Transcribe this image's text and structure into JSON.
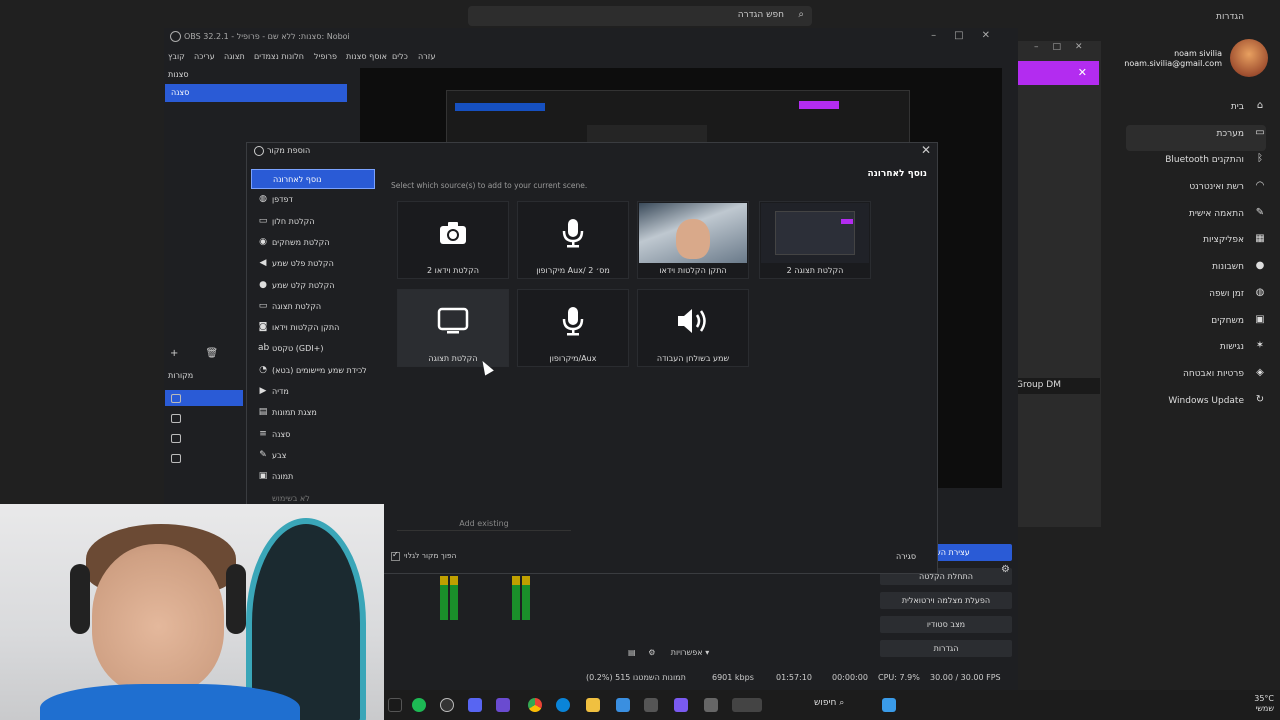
{
  "settings": {
    "title": "הגדרות",
    "search_placeholder": "חפש הגדרה",
    "profile_name": "noam sivilia",
    "profile_email": "noam.sivilia@gmail.com",
    "nav": [
      {
        "label": "בית",
        "icon": "home-icon"
      },
      {
        "label": "מערכת",
        "icon": "monitor-icon"
      },
      {
        "label": "Bluetooth והתקנים",
        "icon": "bluetooth-icon"
      },
      {
        "label": "רשת ואינטרנט",
        "icon": "wifi-icon"
      },
      {
        "label": "התאמה אישית",
        "icon": "brush-icon"
      },
      {
        "label": "אפליקציות",
        "icon": "apps-icon"
      },
      {
        "label": "חשבונות",
        "icon": "person-icon"
      },
      {
        "label": "זמן ושפה",
        "icon": "globe-icon"
      },
      {
        "label": "משחקים",
        "icon": "gamepad-icon"
      },
      {
        "label": "נגישות",
        "icon": "accessibility-icon"
      },
      {
        "label": "פרטיות ואבטחה",
        "icon": "shield-icon"
      },
      {
        "label": "Windows Update",
        "icon": "update-icon"
      }
    ],
    "group_dm": "Group DM"
  },
  "obs": {
    "window_title": "OBS 32.2.1 - סצנות: ללא שם - פרופיל: Noboi",
    "menu": [
      "קובץ",
      "עריכה",
      "תצוגה",
      "חלונות נצמדים",
      "פרופיל",
      "אוסף סצנות",
      "כלים",
      "עזרה"
    ],
    "scenes_title": "סצנות",
    "scene_item": "סצנה",
    "sources_title": "מקורות",
    "controls": [
      {
        "label": "עצירת השידור",
        "active": true
      },
      {
        "label": "התחלת הקלטה",
        "active": false
      },
      {
        "label": "הפעלת מצלמה וירטואלית",
        "active": false
      },
      {
        "label": "מצב סטודיו",
        "active": false
      },
      {
        "label": "הגדרות",
        "active": false
      }
    ],
    "options_label": "אפשרויות",
    "status": {
      "dropped": "(0.2%) 515 תמונות השמטנו",
      "bitrate": "6901 kbps",
      "live_time": "01:57:10",
      "rec_time": "00:00:00",
      "cpu": "CPU: 7.9%",
      "fps": "30.00 / 30.00 FPS"
    }
  },
  "dialog": {
    "title": "הוספת מקור",
    "add_to_scene": "נוסף לאחרונה",
    "hint": "Select which source(s) to add to your current scene.",
    "source_types": [
      {
        "label": "נוסף לאחרונה",
        "icon": "",
        "selected": true
      },
      {
        "label": "דפדפן",
        "icon": "globe-icon"
      },
      {
        "label": "הקלטת חלון",
        "icon": "window-icon"
      },
      {
        "label": "הקלטת משחקים",
        "icon": "gamepad-icon"
      },
      {
        "label": "הקלטת פלט שמע",
        "icon": "speaker-icon"
      },
      {
        "label": "הקלטת קלט שמע",
        "icon": "mic-icon"
      },
      {
        "label": "הקלטת תצוגה",
        "icon": "monitor-icon"
      },
      {
        "label": "התקן הקלטות וידאו",
        "icon": "camera-icon"
      },
      {
        "label": "טקסט (GDI+)",
        "icon": "text-icon"
      },
      {
        "label": "לכידת שמע מיישומים (בטא)",
        "icon": "app-audio-icon"
      },
      {
        "label": "מדיה",
        "icon": "play-icon"
      },
      {
        "label": "מצגת תמונות",
        "icon": "slideshow-icon"
      },
      {
        "label": "סצנה",
        "icon": "list-icon"
      },
      {
        "label": "צבע",
        "icon": "brush-icon"
      },
      {
        "label": "תמונה",
        "icon": "image-icon"
      },
      {
        "label": "לא בשימוש",
        "icon": ""
      }
    ],
    "cards": [
      {
        "label": "הקלטת וידאו 2",
        "icon": "camera-icon",
        "kind": "icon"
      },
      {
        "label": "מיקרופון Aux/ מס׳ 2",
        "icon": "mic-icon",
        "kind": "icon"
      },
      {
        "label": "התקן הקלטות וידאו",
        "icon": "webcam-thumbnail",
        "kind": "cam"
      },
      {
        "label": "הקלטת תצוגה 2",
        "icon": "screen-thumbnail",
        "kind": "screen"
      },
      {
        "label": "הקלטת תצוגה",
        "icon": "monitor-icon",
        "kind": "icon"
      },
      {
        "label": "מיקרופון/Aux",
        "icon": "mic-icon",
        "kind": "icon"
      },
      {
        "label": "שמע בשולחן העבודה",
        "icon": "speaker-icon",
        "kind": "icon"
      }
    ],
    "add_existing": "Add existing",
    "visible_label": "הפוך מקור לגלוי",
    "close_label": "סגירה"
  },
  "taskbar": {
    "search": "חיפוש",
    "weather": "35°C",
    "weather_desc": "שמשי"
  }
}
